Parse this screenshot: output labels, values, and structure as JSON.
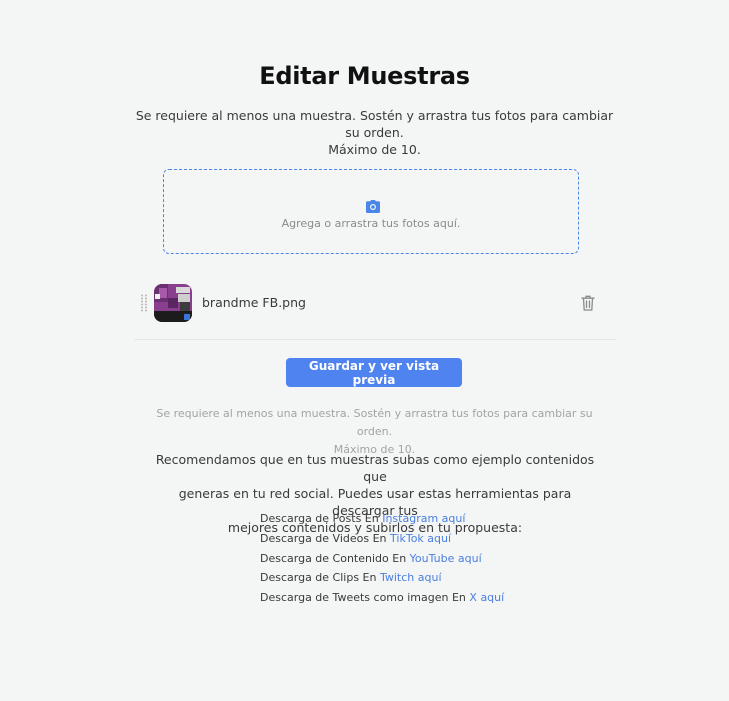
{
  "header": {
    "title": "Editar Muestras",
    "subtitle_line1": "Se requiere al menos una muestra. Sostén y arrastra tus fotos para cambiar su orden.",
    "subtitle_line2": "Máximo de 10."
  },
  "dropzone": {
    "icon": "camera-icon",
    "text": "Agrega o arrastra tus fotos aquí."
  },
  "files": [
    {
      "name": "brandme FB.png",
      "thumbnail_icon": "image-thumbnail",
      "delete_icon": "trash-icon",
      "drag_icon": "drag-handle-icon"
    }
  ],
  "actions": {
    "save_label": "Guardar y ver vista previa"
  },
  "note": {
    "line1": "Se requiere al menos una muestra. Sostén y arrastra tus fotos para cambiar su orden.",
    "line2": "Máximo de 10."
  },
  "recommendation": {
    "line1": "Recomendamos que en tus muestras subas como ejemplo contenidos que",
    "line2": "generas en tu red social. Puedes usar estas herramientas para descargar tus",
    "line3": "mejores contenidos y subirlos en tu propuesta:"
  },
  "download_links": [
    {
      "prefix": "Descarga de Posts En ",
      "link": "Instagram aquí"
    },
    {
      "prefix": "Descarga de Videos En ",
      "link": "TikTok aquí"
    },
    {
      "prefix": "Descarga de Contenido En ",
      "link": "YouTube aquí"
    },
    {
      "prefix": "Descarga de Clips En ",
      "link": "Twitch aquí"
    },
    {
      "prefix": "Descarga de Tweets como imagen En ",
      "link": "X aquí"
    }
  ],
  "colors": {
    "background": "#f4f5f5",
    "accent": "#4f83ef",
    "link": "#4a7fe0",
    "dropzone_border": "#4a86e8",
    "muted_text": "#a3a3a3"
  }
}
